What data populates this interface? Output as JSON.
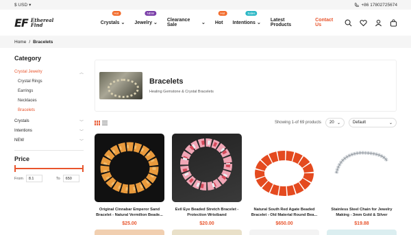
{
  "topbar": {
    "currency": "$ USD",
    "phone": "+86 17802725674"
  },
  "brand": {
    "mark": "EF",
    "name_line1": "Ethereal",
    "name_line2": "Find"
  },
  "nav": [
    {
      "label": "Crystals",
      "badge": "Hot",
      "badge_color": "#f26b2b",
      "dropdown": true
    },
    {
      "label": "Jewelry",
      "badge": "NEW",
      "badge_color": "#7a3ea8",
      "dropdown": true
    },
    {
      "label": "Clearance Sale",
      "badge": "",
      "badge_color": "",
      "dropdown": true
    },
    {
      "label": "Hot",
      "badge": "Hot",
      "badge_color": "#f26b2b",
      "dropdown": false
    },
    {
      "label": "Intentions",
      "badge": "Sales",
      "badge_color": "#2bb7c5",
      "dropdown": true
    },
    {
      "label": "Latest Products",
      "badge": "",
      "badge_color": "",
      "dropdown": false
    },
    {
      "label": "Contact Us",
      "badge": "",
      "badge_color": "",
      "dropdown": false
    }
  ],
  "breadcrumb": {
    "home": "Home",
    "sep": "/",
    "current": "Bracelets"
  },
  "sidebar": {
    "category_heading": "Category",
    "crystal_jewelry": "Crystal Jewelry",
    "subs": [
      "Crystal Rings",
      "Earrings",
      "Necklaces",
      "Bracelets"
    ],
    "others": [
      "Crystals",
      "Intentions",
      "NEW"
    ],
    "price_heading": "Price",
    "from_label": "From",
    "from_value": "8.1",
    "to_label": "To",
    "to_value": "650"
  },
  "category": {
    "title": "Bracelets",
    "subtitle": "Healing Gemstone & Crystal Bracelets"
  },
  "toolbar": {
    "showing": "Showing 1-of 69 products",
    "per_page": "20",
    "sort": "Default"
  },
  "products": [
    {
      "title": "Original Cinnabar Emperor Sand Bracelet - Natural Vermilion Beade...",
      "price": "$25.00"
    },
    {
      "title": "Evil Eye Beaded Stretch Bracelet - Protection Wristband",
      "price": "$20.00"
    },
    {
      "title": "Natural South Red Agate Beaded Bracelet - Old Material Round Bea...",
      "price": "$650.00"
    },
    {
      "title": "Stainless Steel Chain for Jewelry Making - 3mm Gold & Silver",
      "price": "$19.88"
    }
  ],
  "colors": {
    "accent": "#e8542c"
  }
}
